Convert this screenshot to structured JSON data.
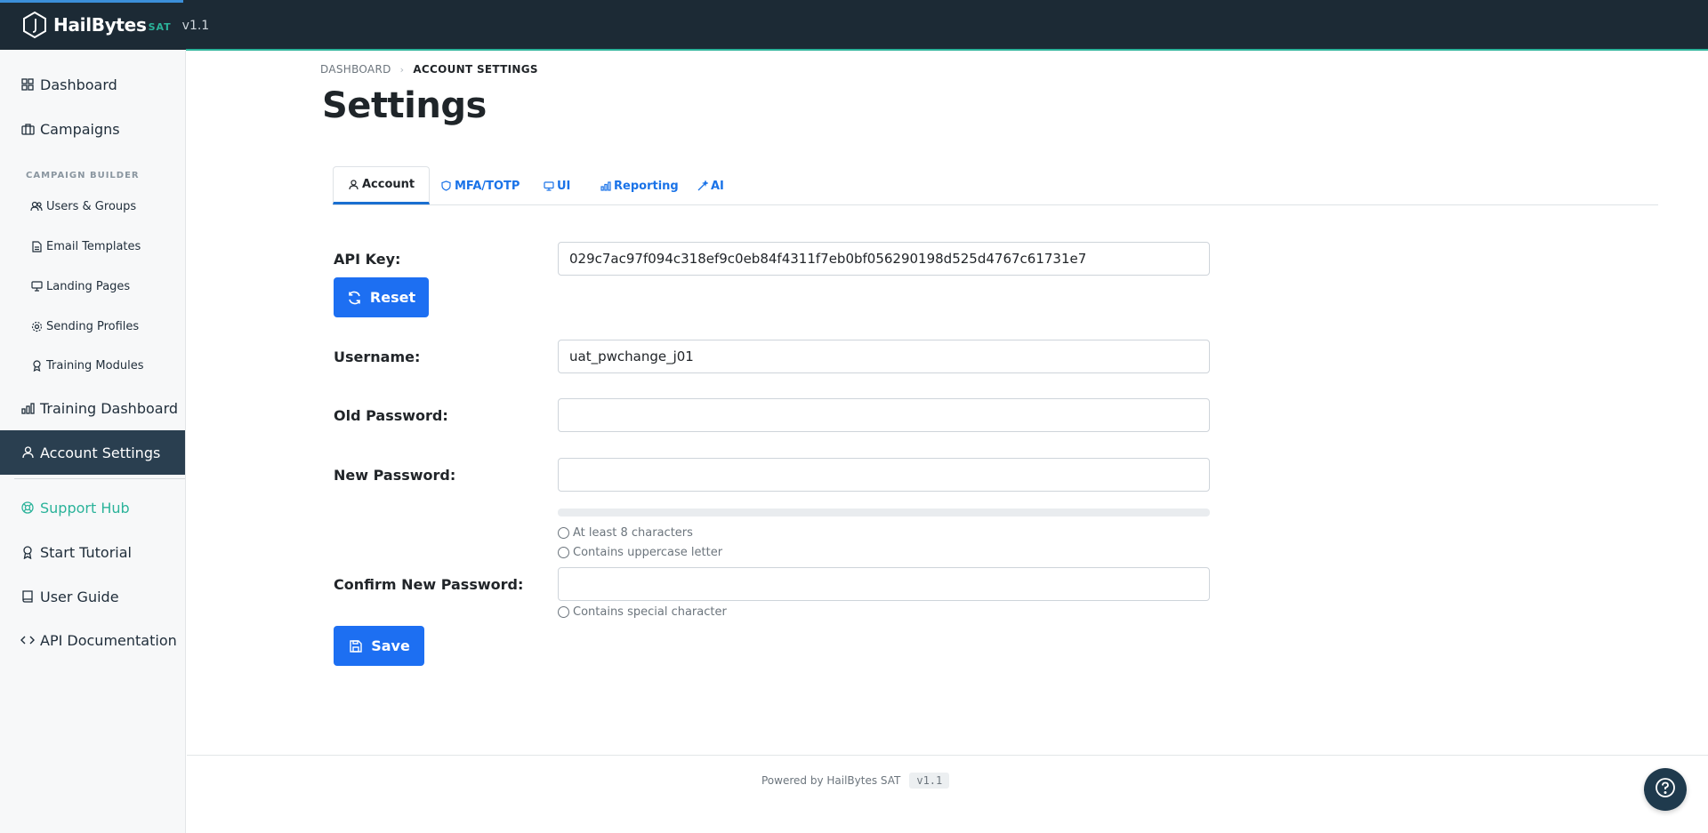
{
  "brand": {
    "name": "HailBytes",
    "suffix": "SAT",
    "version": "v1.1"
  },
  "colors": {
    "topbar": "#1c2a35",
    "accent": "#2bb39a",
    "primary": "#1d6ff2",
    "link": "#1a73e8",
    "sidebar_active": "#2a3f50"
  },
  "sidebar": {
    "dashboard": {
      "label": "Dashboard",
      "icon": "grid-icon"
    },
    "campaigns": {
      "label": "Campaigns",
      "icon": "briefcase-icon"
    },
    "section_label": "CAMPAIGN BUILDER",
    "sub_items": [
      {
        "label": "Users & Groups",
        "icon": "users-icon"
      },
      {
        "label": "Email Templates",
        "icon": "file-icon"
      },
      {
        "label": "Landing Pages",
        "icon": "monitor-icon"
      },
      {
        "label": "Sending Profiles",
        "icon": "gear-icon"
      },
      {
        "label": "Training Modules",
        "icon": "award-icon"
      }
    ],
    "training_dashboard": {
      "label": "Training Dashboard",
      "icon": "bar-chart-icon"
    },
    "account_settings": {
      "label": "Account Settings",
      "icon": "user-icon"
    },
    "support_hub": {
      "label": "Support Hub",
      "icon": "lifebuoy-icon"
    },
    "start_tutorial": {
      "label": "Start Tutorial",
      "icon": "award-icon"
    },
    "user_guide": {
      "label": "User Guide",
      "icon": "book-icon"
    },
    "api_docs": {
      "label": "API Documentation",
      "icon": "code-icon"
    }
  },
  "breadcrumb": {
    "root": "DASHBOARD",
    "current": "ACCOUNT SETTINGS"
  },
  "page_title": "Settings",
  "tabs": [
    {
      "label": "Account",
      "icon": "user-icon"
    },
    {
      "label": "MFA/TOTP",
      "icon": "shield-icon"
    },
    {
      "label": "UI",
      "icon": "monitor-icon"
    },
    {
      "label": "Reporting",
      "icon": "bar-chart-icon"
    },
    {
      "label": "AI",
      "icon": "magic-wand-icon"
    }
  ],
  "form": {
    "api_key_label": "API Key:",
    "api_key_value": "029c7ac97f094c318ef9c0eb84f4311f7eb0bf056290198d525d4767c61731e7",
    "reset_label": "Reset",
    "username_label": "Username:",
    "username_value": "uat_pwchange_j01",
    "old_password_label": "Old Password:",
    "new_password_label": "New Password:",
    "confirm_password_label": "Confirm New Password:",
    "strength_level": 0,
    "requirements": [
      "At least 8 characters",
      "Contains uppercase letter",
      "Contains special character"
    ],
    "save_label": "Save"
  },
  "footer": {
    "text": "Powered by HailBytes SAT",
    "version": "v1.1"
  }
}
